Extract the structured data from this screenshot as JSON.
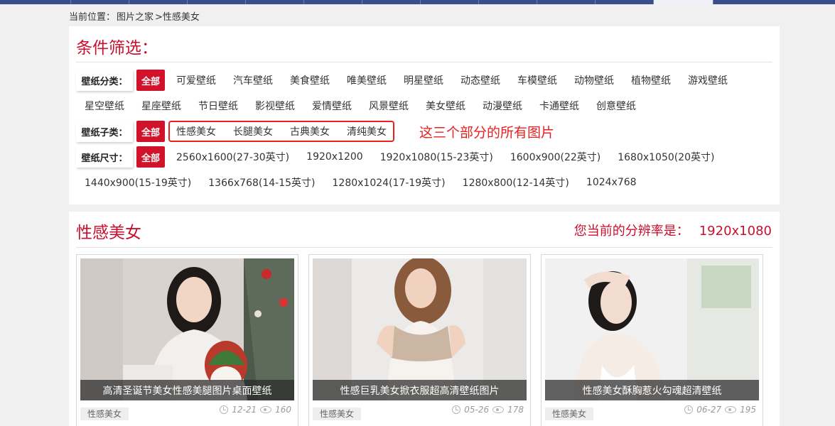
{
  "breadcrumb": {
    "prefix": "当前位置：",
    "home": "图片之家",
    "current": ">性感美女"
  },
  "filter": {
    "title": "条件筛选：",
    "rows": [
      {
        "label": "壁纸分类：",
        "all": "全部",
        "options": [
          "可爱壁纸",
          "汽车壁纸",
          "美食壁纸",
          "唯美壁纸",
          "明星壁纸",
          "动态壁纸",
          "车模壁纸",
          "动物壁纸",
          "植物壁纸",
          "游戏壁纸"
        ],
        "options_line2": [
          "星空壁纸",
          "星座壁纸",
          "节日壁纸",
          "影视壁纸",
          "爱情壁纸",
          "风景壁纸",
          "美女壁纸",
          "动漫壁纸",
          "卡通壁纸",
          "创意壁纸"
        ]
      },
      {
        "label": "壁纸子类：",
        "all": "全部",
        "options": [
          "性感美女",
          "长腿美女",
          "古典美女",
          "清纯美女"
        ]
      },
      {
        "label": "壁纸尺寸：",
        "all": "全部",
        "options": [
          "2560x1600(27-30英寸)",
          "1920x1200",
          "1920x1080(15-23英寸)",
          "1600x900(22英寸)",
          "1680x1050(20英寸)"
        ],
        "options_line2": [
          "1440x900(15-19英寸)",
          "1366x768(14-15英寸)",
          "1280x1024(17-19英寸)",
          "1280x800(12-14英寸)",
          "1024x768"
        ]
      }
    ],
    "annotation": "这三个部分的所有图片"
  },
  "list": {
    "title": "性感美女",
    "resolution_label": "您当前的分辨率是：",
    "resolution_value": "1920x1080",
    "cards": [
      {
        "caption": "高清圣诞节美女性感美腿图片桌面壁纸",
        "tag": "性感美女",
        "date": "12-21",
        "views": "160"
      },
      {
        "caption": "性感巨乳美女掀衣服超高清壁纸图片",
        "tag": "性感美女",
        "date": "05-26",
        "views": "178"
      },
      {
        "caption": "性感美女酥胸惹火勾魂超清壁纸",
        "tag": "性感美女",
        "date": "06-27",
        "views": "195"
      }
    ]
  },
  "colors": {
    "accent": "#c8102e",
    "nav": "#3a4f8a",
    "annotation": "#e8211f"
  }
}
